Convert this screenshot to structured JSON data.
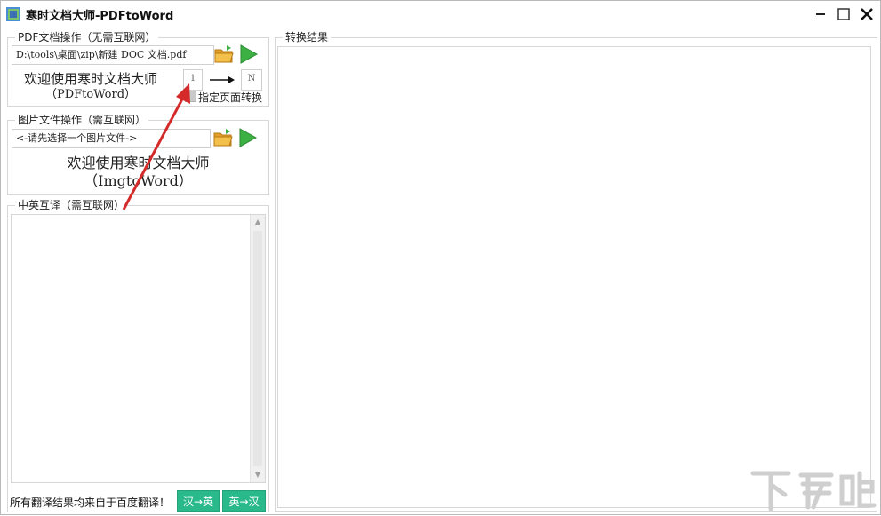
{
  "window": {
    "title": "寒时文档大师-PDFtoWord",
    "controls": [
      "minimize",
      "maximize",
      "close"
    ]
  },
  "pdf_group": {
    "legend": "PDF文档操作（无需互联网）",
    "file_path": "D:\\tools\\桌面\\zip\\新建 DOC 文档.pdf",
    "welcome_line1": "欢迎使用寒时文档大师",
    "welcome_line2": "（PDFtoWord）",
    "page_from": "1",
    "page_to": "N",
    "page_range_checkbox_label": "指定页面转换",
    "page_range_checked": false,
    "open_icon": "folder-open-icon",
    "convert_icon": "play-icon"
  },
  "image_group": {
    "legend": "图片文件操作（需互联网）",
    "placeholder": "<-请先选择一个图片文件->",
    "welcome_line1": "欢迎使用寒时文档大师",
    "welcome_line2": "（ImgtoWord）"
  },
  "translate_group": {
    "legend": "中英互译（需互联网）",
    "footer_note": "所有翻译结果均来自于百度翻译！",
    "zh_to_en_label": "汉→英",
    "en_to_zh_label": "英→汉"
  },
  "result_group": {
    "legend": "转换结果"
  },
  "annotation": {
    "type": "red-arrow",
    "color": "#d42a2a"
  },
  "watermark": {
    "text": "下载吧"
  },
  "colors": {
    "green_button": "#29b98b",
    "play_green": "#3cb043",
    "folder_orange": "#e5a02a"
  }
}
